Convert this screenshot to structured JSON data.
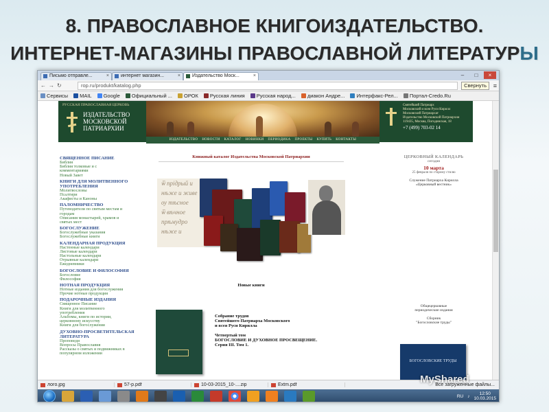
{
  "slide": {
    "title_line1": "8. ПРАВОСЛАВНОЕ КНИГОИЗДАТЕЛЬСТВО.",
    "title_line2_main": "ИНТЕРНЕТ-МАГАЗИНЫ ПРАВОСЛАВНОЙ ЛИТЕРАТУР",
    "title_line2_accent": "Ы"
  },
  "browser": {
    "tabs": [
      {
        "label": "Письмо отправле..."
      },
      {
        "label": "интернет магазин..."
      },
      {
        "label": "Издательство Моск..."
      }
    ],
    "url": "rop.ru/produkt/katalog.php",
    "tooltip": "Свернуть",
    "bookmarks": [
      "Сервисы",
      "MAIL",
      "Google",
      "Официальный ...",
      "ОРОК",
      "Русская линия",
      "Русская народ...",
      "диакон Андре...",
      "Интерфакс-Рел...",
      "Портал-Credo.Ru"
    ]
  },
  "site": {
    "brand_small": "РУССКАЯ ПРАВОСЛАВНАЯ ЦЕРКОВЬ",
    "brand_line1": "ИЗДАТЕЛЬСТВО",
    "brand_line2": "МОСКОВСКОЙ",
    "brand_line3": "ПАТРИАРХИИ",
    "contact_lines": [
      "Святейший Патриарх",
      "Московский и всея Руси Кирилл",
      "Московский Патриархат",
      "Издательство Московской Патриархии",
      "119435, Москва, Погодинская, 18"
    ],
    "phone": "+7 (499) 703-02 14",
    "nav": [
      "ИЗДАТЕЛЬСТВО",
      "НОВОСТИ",
      "КАТАЛОГ",
      "НОВИНКИ",
      "ПЕРИОДИКА",
      "ПРОЕКТЫ",
      "КУПИТЬ",
      "КОНТАКТЫ"
    ]
  },
  "sidebar": [
    {
      "title": "СВЯЩЕННОЕ ПИСАНИЕ",
      "links": [
        "Библия",
        "Библия толковые и с",
        "комментариями",
        "Новый Завет"
      ]
    },
    {
      "title": "КНИГИ ДЛЯ МОЛИТВЕННОГО УПОТРЕБЛЕНИЯ",
      "links": [
        "Молитвословы",
        "Псалтири",
        "Акафисты и Каноны"
      ]
    },
    {
      "title": "ПАЛОМНИЧЕСТВО",
      "links": [
        "Путеводители по святым местам и",
        "городам",
        "Описания монастырей, храмов и",
        "святых мест"
      ]
    },
    {
      "title": "БОГОСЛУЖЕНИЕ",
      "links": [
        "Богослужебные указания",
        "Богослужебные книги"
      ]
    },
    {
      "title": "КАЛЕНДАРНАЯ ПРОДУКЦИЯ",
      "links": [
        "Настенные календари",
        "Листовые календари",
        "Настольные календари",
        "Отрывные календари",
        "Ежедневники"
      ]
    },
    {
      "title": "БОГОСЛОВИЕ И ФИЛОСОФИЯ",
      "links": [
        "Богословие",
        "Философия"
      ]
    },
    {
      "title": "НОТНАЯ ПРОДУКЦИЯ",
      "links": [
        "Нотные издания для богослужения",
        "Прочие нотные продукция"
      ]
    },
    {
      "title": "ПОДАРОЧНЫЕ ИЗДАНИЯ",
      "links": [
        "Священное Писание",
        "Книги для молитвенного",
        "употребления",
        "Альбомы, книги по истории,",
        "церковному искусству",
        "Книги для богослужения"
      ]
    },
    {
      "title": "ДУХОВНО-ПРОСВЕТИТЕЛЬСКАЯ ЛИТЕРАТУРА",
      "links": [
        "Проповеди",
        "Вопросы Православия",
        "Рассказы о святых и подвижниках в",
        "популярном изложении"
      ]
    }
  ],
  "center": {
    "catalog_title": "Книжный каталог Издательства Московской Патриархии",
    "manuscript_lines": [
      "ѿ прідрый и",
      "нѣже и живе",
      "ѹ тѣсное",
      "ѿ вѣчное",
      "прѣмудро",
      "нѣже и"
    ],
    "new_books_title": "Новые книги",
    "new_book_lines": [
      "Собрание трудов",
      "Святейшего Патриарха Московского",
      "и всея Руси Кирилла",
      "",
      "Четвертый том",
      "БОГОСЛОВИЕ И ДУХОВНОЕ ПРОСВЕЩЕНИЕ.",
      "Серия III. Том 1."
    ]
  },
  "right": {
    "calendar_title": "ЦЕРКОВНЫЙ КАЛЕНДАРЬ",
    "today": "сегодня",
    "date": "10 марта",
    "old_style": "25 февраля по старому стилю",
    "service_line1": "Служение Патриарха Кирилла",
    "service_line2": "«Церковный вестник»",
    "periodic_line1": "Общецерковные",
    "periodic_line2": "периодические издания",
    "collection_line1": "Сборник",
    "collection_line2": "\"Богословские труды\"",
    "journal_label": "БОГОСЛОВСКИЕ ТРУДЫ"
  },
  "downloads": {
    "items": [
      "лого.jpg",
      "57-р.pdf",
      "10-03-2015_10-....zip",
      "Extm.pdf"
    ],
    "show_all": "Все загруженные файлы..."
  },
  "taskbar": {
    "lang": "RU",
    "time": "12:50",
    "date": "10.03.2015"
  },
  "watermark": "MyShared"
}
